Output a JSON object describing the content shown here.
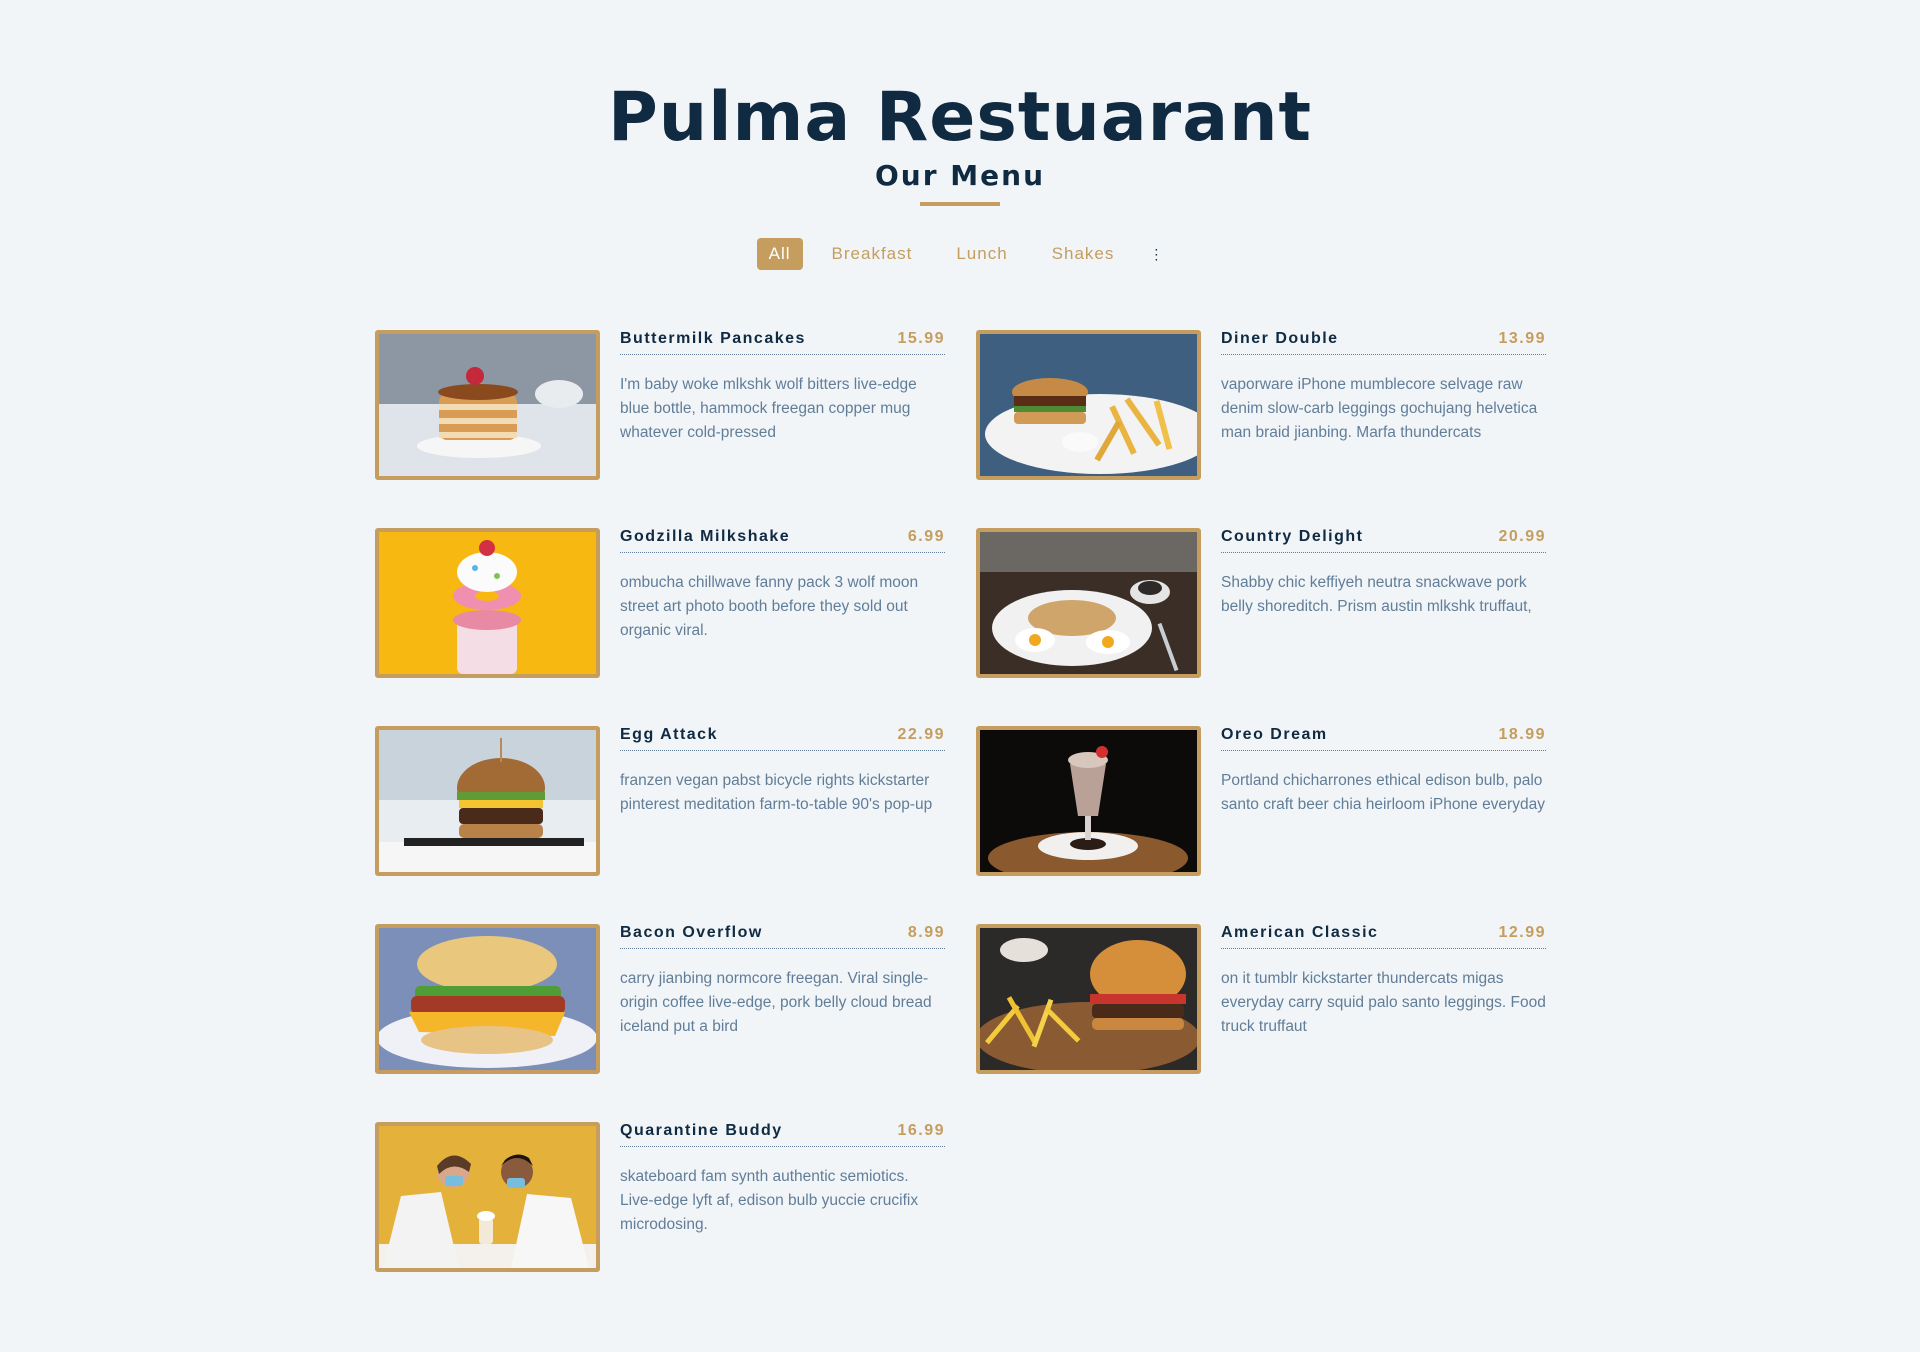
{
  "header": {
    "title": "Pulma Restuarant",
    "subtitle": "Our Menu"
  },
  "filters": [
    "All",
    "Breakfast",
    "Lunch",
    "Shakes"
  ],
  "active_filter": "All",
  "colors": {
    "background": "#f1f5f8",
    "primary": "#102a42",
    "accent": "#c59d5f",
    "muted": "#617d98"
  },
  "items": [
    {
      "name": "Buttermilk Pancakes",
      "price": "15.99",
      "desc": "I'm baby woke mlkshk wolf bitters live-edge blue bottle, hammock freegan copper mug whatever cold-pressed"
    },
    {
      "name": "Diner Double",
      "price": "13.99",
      "desc": "vaporware iPhone mumblecore selvage raw denim slow-carb leggings gochujang helvetica man braid jianbing. Marfa thundercats"
    },
    {
      "name": "Godzilla Milkshake",
      "price": "6.99",
      "desc": "ombucha chillwave fanny pack 3 wolf moon street art photo booth before they sold out organic viral."
    },
    {
      "name": "Country Delight",
      "price": "20.99",
      "desc": "Shabby chic keffiyeh neutra snackwave pork belly shoreditch. Prism austin mlkshk truffaut,"
    },
    {
      "name": "Egg Attack",
      "price": "22.99",
      "desc": "franzen vegan pabst bicycle rights kickstarter pinterest meditation farm-to-table 90's pop-up"
    },
    {
      "name": "Oreo Dream",
      "price": "18.99",
      "desc": "Portland chicharrones ethical edison bulb, palo santo craft beer chia heirloom iPhone everyday"
    },
    {
      "name": "Bacon Overflow",
      "price": "8.99",
      "desc": "carry jianbing normcore freegan. Viral single-origin coffee live-edge, pork belly cloud bread iceland put a bird"
    },
    {
      "name": "American Classic",
      "price": "12.99",
      "desc": "on it tumblr kickstarter thundercats migas everyday carry squid palo santo leggings. Food truck truffaut"
    },
    {
      "name": "Quarantine Buddy",
      "price": "16.99",
      "desc": "skateboard fam synth authentic semiotics. Live-edge lyft af, edison bulb yuccie crucifix microdosing."
    }
  ]
}
